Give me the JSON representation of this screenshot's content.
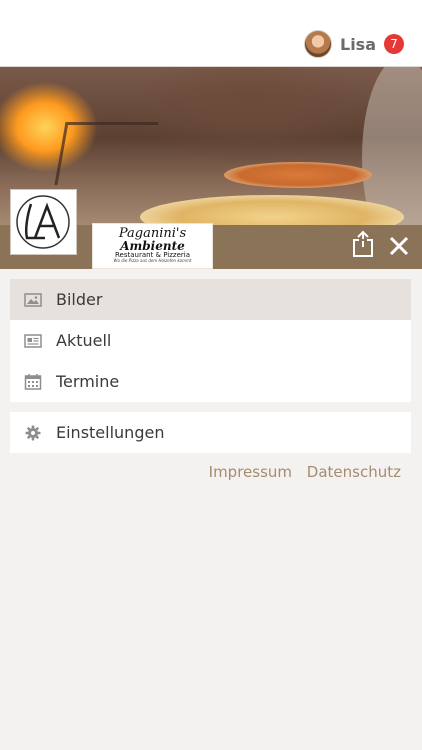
{
  "header": {
    "user_name": "Lisa",
    "notification_count": "7"
  },
  "brand": {
    "logo_monogram": "LA",
    "logo_name_line1": "Paganini's",
    "logo_name_line2": "Ambiente",
    "logo_subtitle": "Restaurant & Pizzeria",
    "logo_tagline": "Wo die Pizza aus dem Holzofen kommt",
    "strip_color": "#8b7358"
  },
  "menu": {
    "items": [
      {
        "label": "Bilder",
        "icon": "image-icon",
        "active": true
      },
      {
        "label": "Aktuell",
        "icon": "newspaper-icon",
        "active": false
      },
      {
        "label": "Termine",
        "icon": "calendar-icon",
        "active": false
      }
    ],
    "settings": {
      "label": "Einstellungen",
      "icon": "gear-icon"
    }
  },
  "footer": {
    "impressum": "Impressum",
    "datenschutz": "Datenschutz"
  },
  "colors": {
    "accent_text": "#a58c6e",
    "badge": "#e53935",
    "active_row": "#e6e1dc"
  }
}
